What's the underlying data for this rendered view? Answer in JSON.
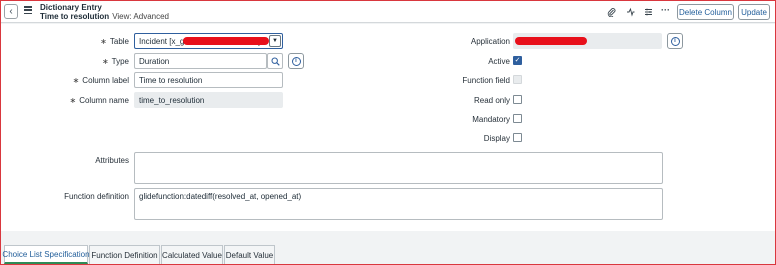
{
  "header": {
    "record_type": "Dictionary Entry",
    "record_name": "Time to resolution",
    "view": "View: Advanced",
    "delete_label": "Delete Column",
    "update_label": "Update"
  },
  "form": {
    "table_label": "Table",
    "table_value": "Incident [x_g",
    "table_value_suffix": "]...",
    "type_label": "Type",
    "type_value": "Duration",
    "column_label_label": "Column label",
    "column_label_value": "Time to resolution",
    "column_name_label": "Column name",
    "column_name_value": "time_to_resolution",
    "required_mark": "∗",
    "application_label": "Application",
    "active_label": "Active",
    "function_field_label": "Function field",
    "read_only_label": "Read only",
    "mandatory_label": "Mandatory",
    "display_label": "Display",
    "attributes_label": "Attributes",
    "attributes_value": "",
    "function_definition_label": "Function definition",
    "function_definition_value": "glidefunction:datediff(resolved_at, opened_at)",
    "checkmark": "✓"
  },
  "checkboxes": {
    "active": true,
    "function_field": false,
    "read_only": false,
    "mandatory": false,
    "display": false
  },
  "tabs": [
    {
      "label": "Choice List Specification",
      "active": true
    },
    {
      "label": "Function Definition",
      "active": false
    },
    {
      "label": "Calculated Value",
      "active": false
    },
    {
      "label": "Default Value",
      "active": false
    }
  ],
  "icons": {
    "back": "‹",
    "attachment": "📎",
    "activity": "⚡",
    "settings": "☷",
    "more": "···",
    "search": "⌕",
    "dropdown": "▼",
    "info": "i"
  },
  "colors": {
    "accent": "#2f5f9e",
    "redaction": "#e8101b",
    "active_tab_underline": "#2e8b57",
    "frame_border": "#d9373e"
  }
}
